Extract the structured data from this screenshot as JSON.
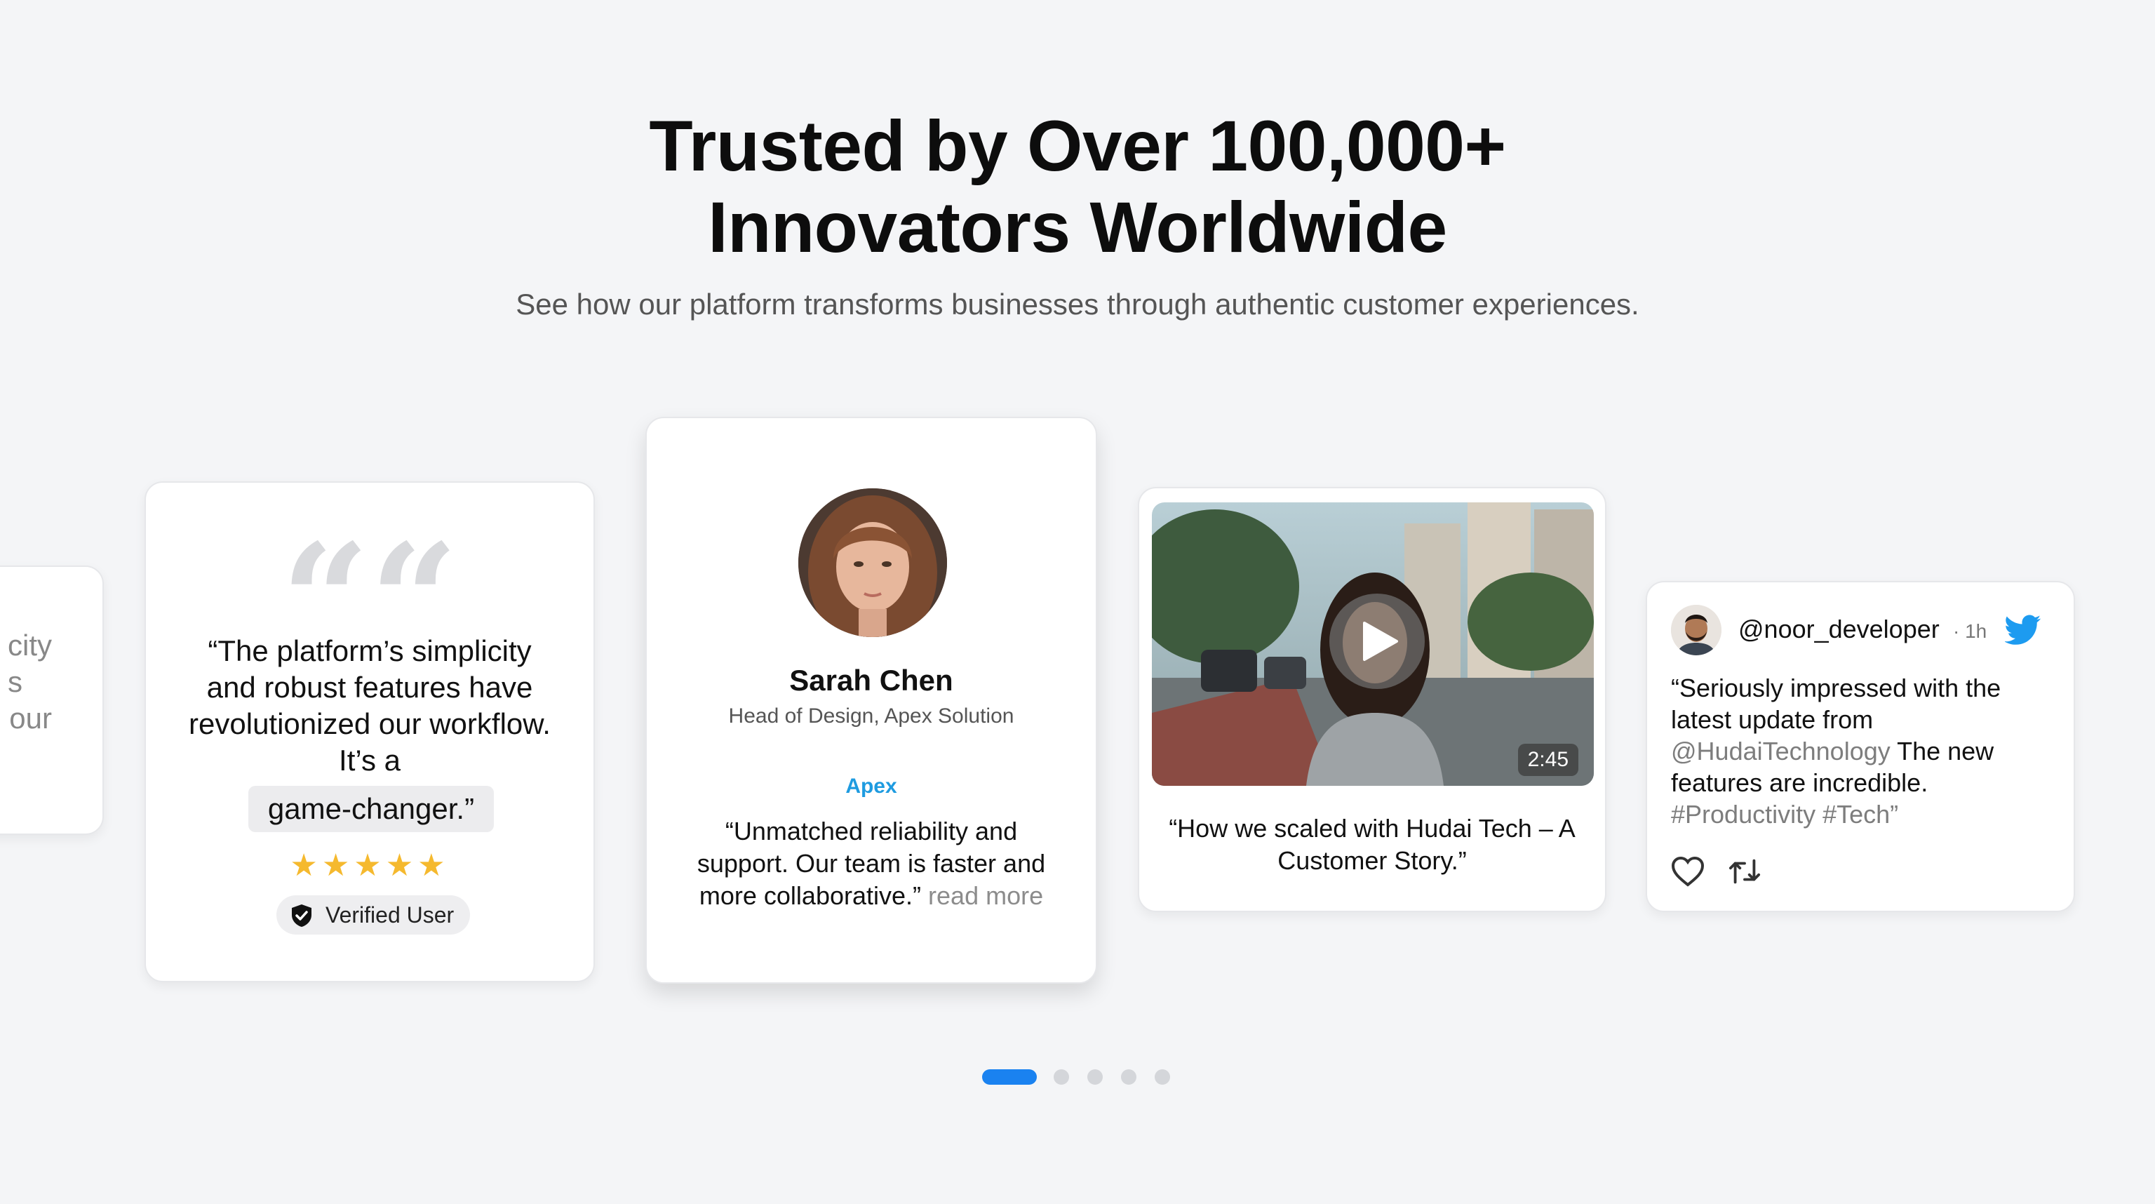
{
  "header": {
    "title_line1": "Trusted by Over 100,000+",
    "title_line2": "Innovators Worldwide",
    "subtitle": "See how our platform transforms businesses through authentic customer experiences."
  },
  "partial_card": {
    "lines": [
      "city",
      "s",
      "our"
    ]
  },
  "quote_card": {
    "quote_mark": "““",
    "text": "“The platform’s simplicity and robust features have revolutionized our workflow. It’s a",
    "highlight": "game-changer.”",
    "stars": "★★★★★",
    "rating": 5,
    "badge": "Verified User"
  },
  "profile_card": {
    "name": "Sarah Chen",
    "role": "Head of Design, Apex Solution",
    "brand": "Apex",
    "text": "“Unmatched reliability and support. Our team is faster and more collaborative.”",
    "read_more": "read more"
  },
  "video_card": {
    "duration": "2:45",
    "caption": "“How we scaled with Hudai Tech – A Customer Story.”"
  },
  "tweet_card": {
    "handle": "@noor_developer",
    "time": "· 1h",
    "text_start": "“Seriously impressed with the latest update from",
    "mention": "@HudaiTechnology",
    "text_mid": "The new features are incredible.",
    "hashtags": "#Productivity #Tech”"
  },
  "pagination": {
    "total": 5,
    "active_index": 0
  },
  "colors": {
    "background": "#f4f5f7",
    "accent": "#1a82f0",
    "star": "#f5b92e",
    "brand": "#1e9be0",
    "twitter": "#1d9bf0"
  },
  "icons": [
    "quote-icon",
    "star-icon",
    "shield-check-icon",
    "play-icon",
    "twitter-bird-icon",
    "heart-icon",
    "retweet-icon"
  ]
}
